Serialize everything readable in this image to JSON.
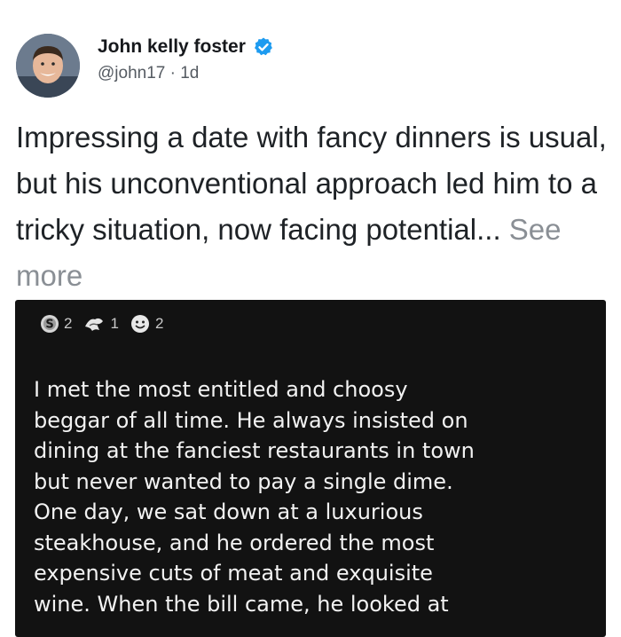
{
  "author": {
    "name": "John kelly foster",
    "handle": "@john17",
    "separator": "·",
    "time": "1d",
    "verified_icon": "verified-badge-icon",
    "accent_color": "#1d9bf0"
  },
  "caption": {
    "text": "Impressing a date with fancy dinners is usual, but his unconventional approach led him to a tricky situation, now facing potential...",
    "see_more": "See more"
  },
  "post": {
    "awards": [
      {
        "icon": "silver-award-icon",
        "count": "2"
      },
      {
        "icon": "helpful-award-icon",
        "count": "1"
      },
      {
        "icon": "wholesome-award-icon",
        "count": "2"
      }
    ],
    "body": "I met the most entitled and choosy\nbeggar of all time. He always insisted on\ndining at the fanciest restaurants in town\nbut never wanted to pay a single dime.\nOne day, we sat down at a luxurious\nsteakhouse, and he ordered the most\nexpensive cuts of meat and exquisite\nwine. When the bill came, he looked at"
  }
}
